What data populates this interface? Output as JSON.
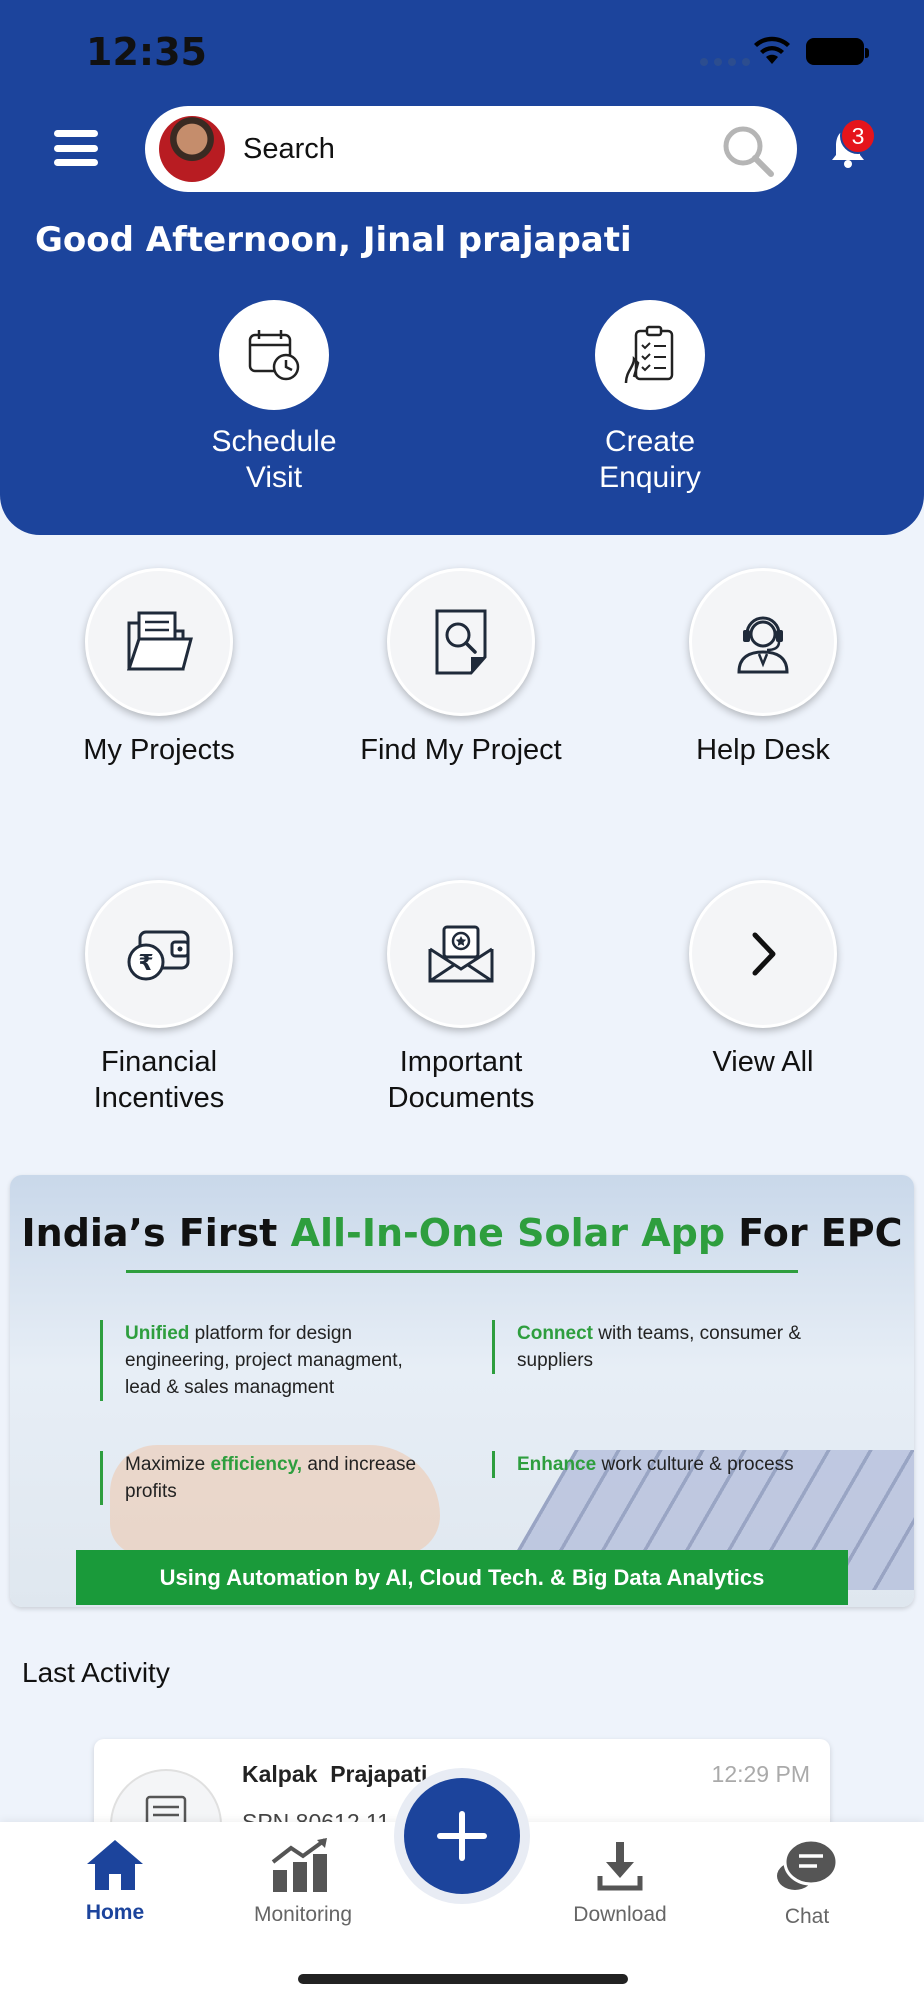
{
  "status_bar": {
    "time": "12:35"
  },
  "header": {
    "search_placeholder": "Search",
    "notification_count": "3",
    "greeting": "Good Afternoon, Jinal prajapati"
  },
  "quick_actions": [
    {
      "label": "Schedule\nVisit",
      "icon": "calendar-clock-icon"
    },
    {
      "label": "Create\nEnquiry",
      "icon": "clipboard-checklist-icon"
    }
  ],
  "tiles": [
    {
      "label": "My Projects",
      "icon": "folder-documents-icon"
    },
    {
      "label": "Find My Project",
      "icon": "document-search-icon"
    },
    {
      "label": "Help Desk",
      "icon": "support-agent-icon"
    },
    {
      "label": "Financial\nIncentives",
      "icon": "rupee-wallet-icon"
    },
    {
      "label": "Important\nDocuments",
      "icon": "certificate-envelope-icon"
    },
    {
      "label": "View All",
      "icon": "chevron-right-icon"
    }
  ],
  "banner": {
    "title_prefix": "India’s First ",
    "title_highlight": "All-In-One Solar App",
    "title_suffix": " For EPC",
    "points": [
      {
        "highlight": "Unified",
        "text": " platform for design engineering, project managment, lead & sales managment"
      },
      {
        "highlight": "Connect",
        "text": " with teams, consumer & suppliers"
      },
      {
        "prefix": "Maximize ",
        "highlight": "efficiency,",
        "text": " and increase profits"
      },
      {
        "highlight": "Enhance",
        "text": " work culture & process"
      }
    ],
    "footer": "Using Automation by AI, Cloud Tech. & Big Data Analytics"
  },
  "last_activity": {
    "heading": "Last Activity",
    "items": [
      {
        "name": "Kalpak  Prajapati",
        "time": "12:29 PM",
        "sub": "SPN 80612  11"
      }
    ]
  },
  "tabbar": {
    "items": [
      {
        "label": "Home",
        "icon": "home-icon",
        "active": true
      },
      {
        "label": "Monitoring",
        "icon": "bar-chart-trend-icon"
      },
      {
        "label": "Download",
        "icon": "download-icon"
      },
      {
        "label": "Chat",
        "icon": "chat-bubbles-icon"
      }
    ]
  },
  "colors": {
    "primary": "#1c449c",
    "accent_green": "#2e9e3e",
    "badge_red": "#e5141b"
  }
}
